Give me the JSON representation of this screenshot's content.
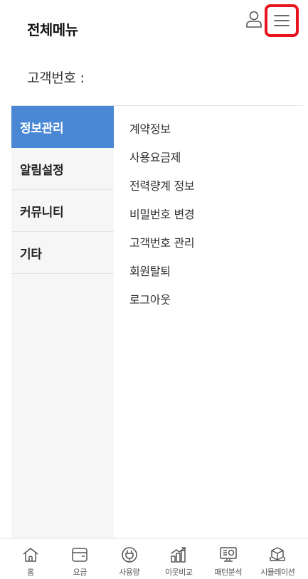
{
  "header": {
    "title": "전체메뉴",
    "user_icon": "user-icon",
    "menu_icon": "hamburger-icon",
    "highlight_color": "#e8131c"
  },
  "customer": {
    "label": "고객번호 :"
  },
  "left_nav": {
    "active_color": "#4a88d6",
    "items": [
      {
        "label": "정보관리",
        "active": true
      },
      {
        "label": "알림설정",
        "active": false
      },
      {
        "label": "커뮤니티",
        "active": false
      },
      {
        "label": "기타",
        "active": false
      }
    ]
  },
  "submenu": {
    "items": [
      {
        "label": "계약정보"
      },
      {
        "label": "사용요금제"
      },
      {
        "label": "전력량계 정보"
      },
      {
        "label": "비밀번호 변경"
      },
      {
        "label": "고객번호 관리"
      },
      {
        "label": "회원탈퇴"
      },
      {
        "label": "로그아웃"
      }
    ]
  },
  "bottom_nav": {
    "tabs": [
      {
        "label": "홈",
        "icon": "home-icon"
      },
      {
        "label": "요금",
        "icon": "wallet-icon"
      },
      {
        "label": "사용량",
        "icon": "plug-icon"
      },
      {
        "label": "이웃비교",
        "icon": "bar-chart-icon"
      },
      {
        "label": "패턴분석",
        "icon": "monitor-chart-icon"
      },
      {
        "label": "시뮬레이션",
        "icon": "cube-icon"
      }
    ]
  }
}
